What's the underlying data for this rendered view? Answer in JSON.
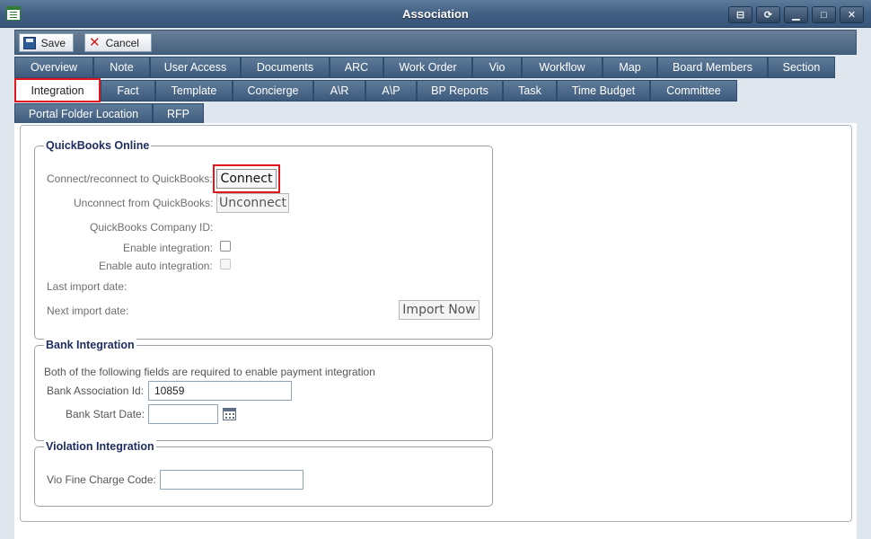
{
  "window": {
    "title": "Association",
    "controls": [
      "pin",
      "refresh",
      "minimize",
      "maximize",
      "close"
    ]
  },
  "toolbar": {
    "save_label": "Save",
    "cancel_label": "Cancel"
  },
  "tabs": {
    "row1": [
      "Overview",
      "Note",
      "User Access",
      "Documents",
      "ARC",
      "Work Order",
      "Vio",
      "Workflow",
      "Map",
      "Board Members",
      "Section"
    ],
    "row2": [
      "Integration",
      "Fact",
      "Template",
      "Concierge",
      "A\\R",
      "A\\P",
      "BP Reports",
      "Task",
      "Time Budget",
      "Committee"
    ],
    "row3": [
      "Portal Folder Location",
      "RFP"
    ],
    "active": "Integration"
  },
  "quickbooks": {
    "legend": "QuickBooks Online",
    "connect_label": "Connect/reconnect to QuickBooks:",
    "connect_button": "Connect",
    "unconnect_label": "Unconnect from QuickBooks:",
    "unconnect_button": "Unconnect",
    "company_id_label": "QuickBooks Company ID:",
    "enable_integration_label": "Enable integration:",
    "enable_integration_checked": false,
    "enable_auto_label": "Enable auto integration:",
    "enable_auto_checked": false,
    "last_import_label": "Last import date:",
    "next_import_label": "Next import date:",
    "import_now_button": "Import Now"
  },
  "bank": {
    "legend": "Bank Integration",
    "note": "Both of the following fields are required to enable payment integration",
    "association_id_label": "Bank Association Id:",
    "association_id_value": "10859",
    "start_date_label": "Bank Start Date:",
    "start_date_value": ""
  },
  "violation": {
    "legend": "Violation Integration",
    "fine_code_label": "Vio Fine Charge Code:",
    "fine_code_value": ""
  },
  "colors": {
    "highlight": "#e0161d",
    "tab_bg": "#4a6788",
    "legend_text": "#1d2c5e"
  }
}
